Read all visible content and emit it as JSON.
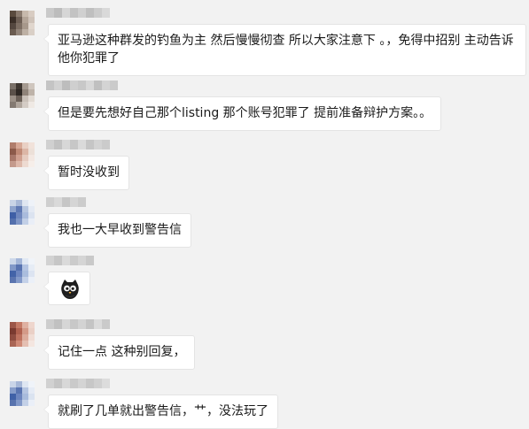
{
  "messages": [
    {
      "text": "亚马逊这种群发的钓鱼为主 然后慢慢彻查 所以大家注意下 。，免得中招别 主动告诉他你犯罪了",
      "avatar_colors": [
        "#5a4a3e",
        "#8a7a6e",
        "#c7b9ac",
        "#d8ccc2",
        "#3b2f28",
        "#6e5f55",
        "#b3a497",
        "#cfc3b9",
        "#54473f",
        "#7d6e63",
        "#a7988b",
        "#e0d6cd",
        "#6b5c51",
        "#93857a",
        "#bdb0a4",
        "#d9cfc6"
      ]
    },
    {
      "text": "但是要先想好自己那个listing 那个账号犯罪了 提前准备辩护方案。。",
      "avatar_colors": [
        "#7a7068",
        "#3e3630",
        "#a59a90",
        "#cfc6be",
        "#5b514a",
        "#2e2824",
        "#8f8379",
        "#beb3a9",
        "#9b9087",
        "#6a5f57",
        "#c9c0b8",
        "#e2dbd4",
        "#847a72",
        "#b0a69d",
        "#d4ccc5",
        "#efe9e4"
      ]
    },
    {
      "text": "暂时没收到",
      "avatar_colors": [
        "#b07d6c",
        "#d7a896",
        "#e9d0c4",
        "#f1e2da",
        "#8c5a4a",
        "#c08a76",
        "#dcb6a6",
        "#ece0d8",
        "#a8786a",
        "#d0a090",
        "#e6cbbf",
        "#f3e8e2",
        "#c49a8c",
        "#deb9ab",
        "#eddad1",
        "#f6eee9"
      ]
    },
    {
      "text": "我也一大早收到警告信",
      "avatar_colors": [
        "#c9d4e6",
        "#a8b8d6",
        "#dfe6f1",
        "#eef2f8",
        "#8ea3cc",
        "#5f79b3",
        "#b7c6e0",
        "#e4eaf4",
        "#3f5fa6",
        "#6f87bd",
        "#a9bbdc",
        "#dbe3f0",
        "#5470ad",
        "#7f96c6",
        "#c2cfe6",
        "#e9eef7"
      ]
    },
    {
      "type": "emoji",
      "avatar_colors": [
        "#cdd8ea",
        "#a4b6d8",
        "#e1e8f3",
        "#f0f4f9",
        "#8299c8",
        "#5873b0",
        "#b4c4e2",
        "#e6ecf5",
        "#4263a8",
        "#6d86bf",
        "#aabddd",
        "#dce4f1",
        "#5a74af",
        "#839ac9",
        "#c4d1e8",
        "#ebf0f8"
      ]
    },
    {
      "text": "记住一点 这种别回复，",
      "avatar_colors": [
        "#9c5648",
        "#c47a66",
        "#dfb1a2",
        "#eed6cd",
        "#7a3a30",
        "#b0614f",
        "#d49a88",
        "#ead0c6",
        "#8e4c40",
        "#be725f",
        "#dcab9b",
        "#f0ddd5",
        "#a96555",
        "#cf8a77",
        "#e4bfb2",
        "#f4e6e0"
      ]
    },
    {
      "text": "就刷了几单就出警告信，艹，没法玩了",
      "avatar_colors": [
        "#cad5e8",
        "#a6b7d7",
        "#dee6f2",
        "#eff3f9",
        "#879dca",
        "#5a75b1",
        "#b5c5e1",
        "#e5ebf5",
        "#4061a7",
        "#6c85be",
        "#a8bbdc",
        "#dae3f0",
        "#5873ae",
        "#8198c8",
        "#c3d0e7",
        "#eaeff8"
      ]
    }
  ]
}
